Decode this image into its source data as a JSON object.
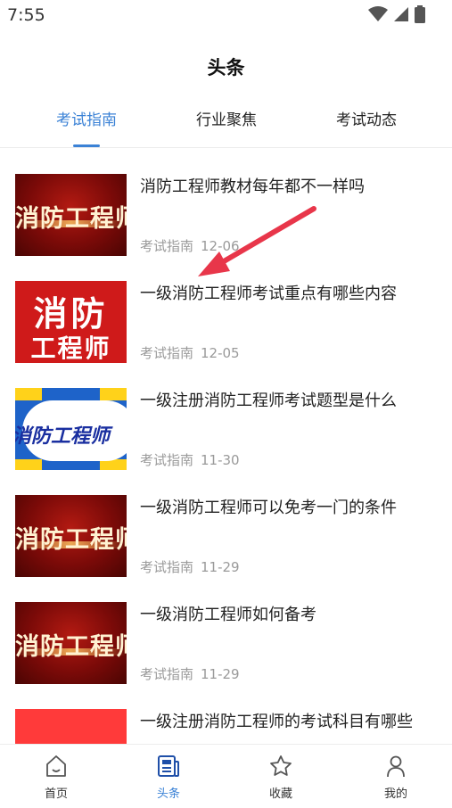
{
  "status": {
    "time": "7:55"
  },
  "page": {
    "title": "头条"
  },
  "tabs": [
    {
      "label": "考试指南",
      "active": true
    },
    {
      "label": "行业聚焦",
      "active": false
    },
    {
      "label": "考试动态",
      "active": false
    }
  ],
  "articles": [
    {
      "title": "消防工程师教材每年都不一样吗",
      "category": "考试指南",
      "date": "12-06",
      "thumb_text": "消防工程师",
      "thumb_style": "dark-red"
    },
    {
      "title": "一级消防工程师考试重点有哪些内容",
      "category": "考试指南",
      "date": "12-05",
      "thumb_text_1": "消防",
      "thumb_text_2": "工程师",
      "thumb_style": "red"
    },
    {
      "title": "一级注册消防工程师考试题型是什么",
      "category": "考试指南",
      "date": "11-30",
      "thumb_text": "消防工程师",
      "thumb_style": "cloud"
    },
    {
      "title": "一级消防工程师可以免考一门的条件",
      "category": "考试指南",
      "date": "11-29",
      "thumb_text": "消防工程师",
      "thumb_style": "dark-red"
    },
    {
      "title": "一级消防工程师如何备考",
      "category": "考试指南",
      "date": "11-29",
      "thumb_text": "消防工程师",
      "thumb_style": "dark-red"
    },
    {
      "title": "一级注册消防工程师的考试科目有哪些",
      "category": "",
      "date": "",
      "thumb_style": "plain-red"
    }
  ],
  "bottom_nav": [
    {
      "label": "首页",
      "icon": "home-icon",
      "active": false
    },
    {
      "label": "头条",
      "icon": "news-icon",
      "active": true
    },
    {
      "label": "收藏",
      "icon": "star-icon",
      "active": false
    },
    {
      "label": "我的",
      "icon": "user-icon",
      "active": false
    }
  ],
  "colors": {
    "accent": "#3b82d6",
    "annotation_arrow": "#e8364a"
  }
}
